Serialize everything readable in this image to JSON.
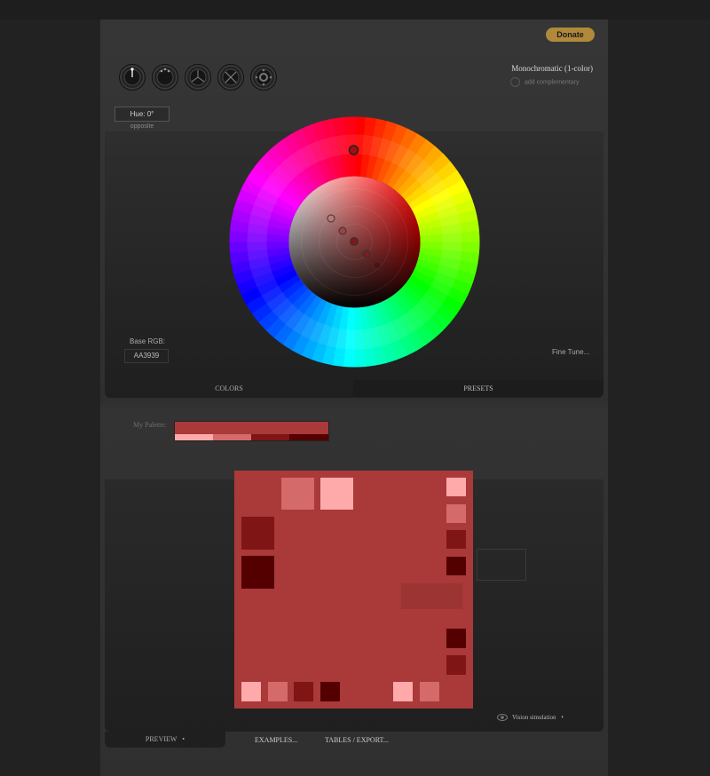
{
  "header": {
    "donate_label": "Donate",
    "colors": {
      "donate_bg": "#b08a3a",
      "page_bg": "#222222"
    }
  },
  "scheme": {
    "modes": [
      {
        "name": "mono-mode-icon"
      },
      {
        "name": "complement-mode-icon"
      },
      {
        "name": "triad-mode-icon"
      },
      {
        "name": "tetrad-mode-icon"
      },
      {
        "name": "analogic-mode-icon"
      }
    ],
    "name": "Monochromatic (1-color)",
    "add_complementary_label": "add complementary"
  },
  "hue": {
    "label": "Hue: 0°",
    "opposite_label": "opposite"
  },
  "base_rgb": {
    "label": "Base RGB:",
    "value": "AA3939"
  },
  "fine_tune_label": "Fine Tune...",
  "tabs_top": {
    "colors": "COLORS",
    "presets": "PRESETS"
  },
  "my_palette": {
    "label": "My Palette:",
    "main_color": "#AA3939",
    "swatches": [
      "#FFAAAA",
      "#D46A6A",
      "#801515",
      "#550000"
    ]
  },
  "preview": {
    "bg_color": "#AA3939",
    "palette": {
      "lightest": "#FFAAAA",
      "light": "#D46A6A",
      "dark": "#801515",
      "darkest": "#550000"
    }
  },
  "vision_simulation_label": "Vision simulation",
  "tabs_bottom": {
    "preview": "PREVIEW",
    "examples": "EXAMPLES...",
    "tables": "TABLES / EXPORT..."
  }
}
